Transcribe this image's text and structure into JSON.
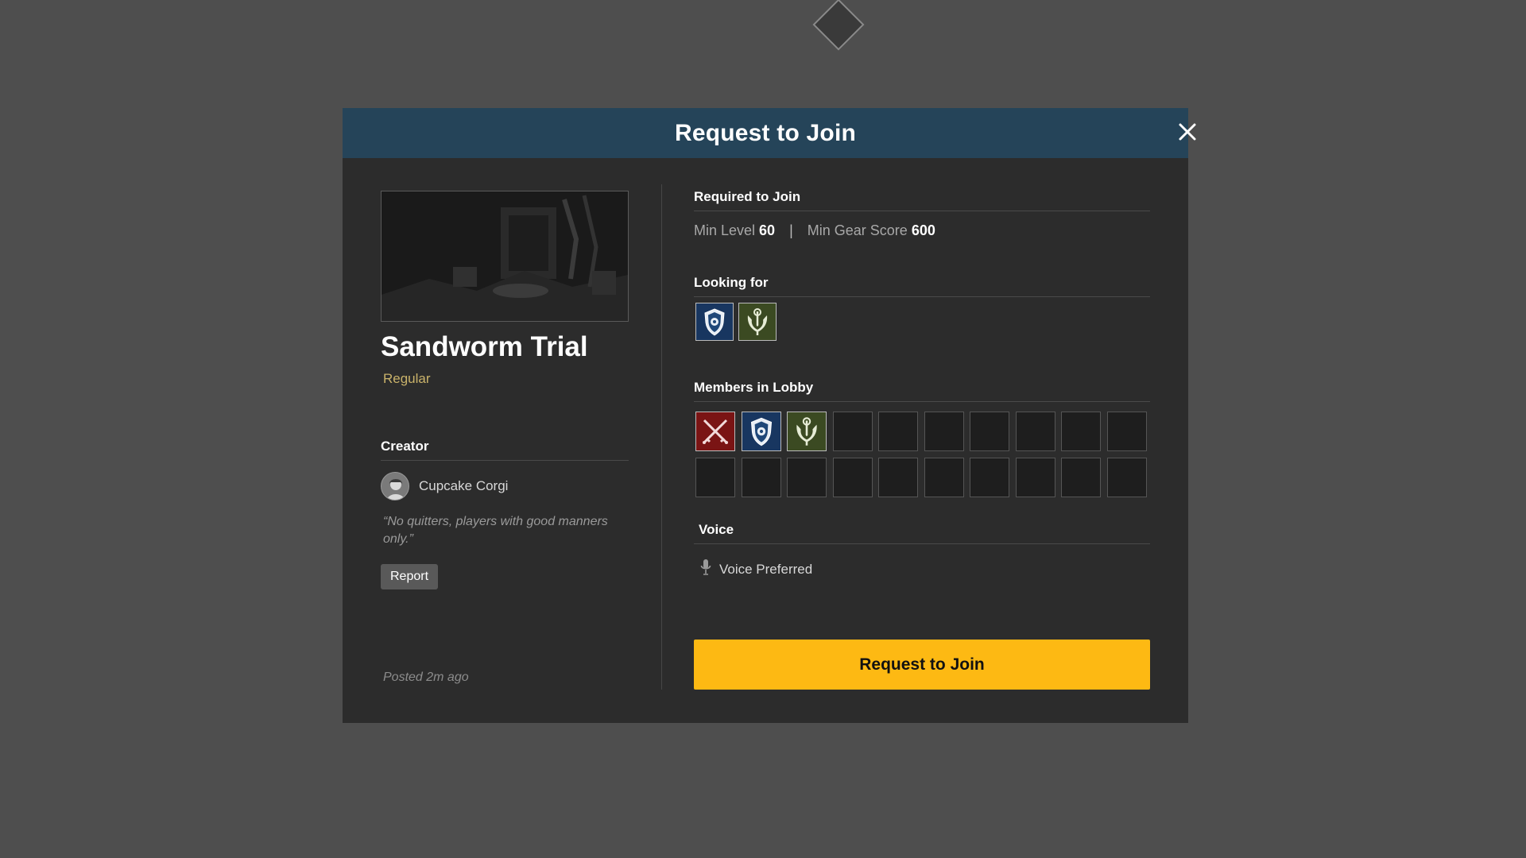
{
  "modal": {
    "title": "Request to Join",
    "close_icon": "close-icon",
    "colors": {
      "header": "#254459",
      "panel": "#2c2c2c",
      "accent": "#fdb913",
      "difficulty": "#c9b26a"
    }
  },
  "activity": {
    "name": "Sandworm Trial",
    "difficulty": "Regular"
  },
  "creator": {
    "label": "Creator",
    "name": "Cupcake Corgi",
    "note": "“No quitters, players with good manners only.”",
    "report_label": "Report",
    "posted": "Posted 2m ago"
  },
  "requirements": {
    "label": "Required to Join",
    "min_level_label": "Min Level",
    "min_level": "60",
    "separator": "|",
    "min_gear_label": "Min Gear Score",
    "min_gear": "600"
  },
  "looking_for": {
    "label": "Looking for",
    "roles": [
      "tank-icon",
      "healer-icon"
    ]
  },
  "lobby": {
    "label": "Members in Lobby",
    "capacity": 20,
    "members": [
      "dps-icon",
      "tank-icon",
      "healer-icon"
    ]
  },
  "voice": {
    "label": "Voice",
    "icon": "microphone-icon",
    "value": "Voice Preferred"
  },
  "join_button": {
    "label": "Request to Join"
  }
}
